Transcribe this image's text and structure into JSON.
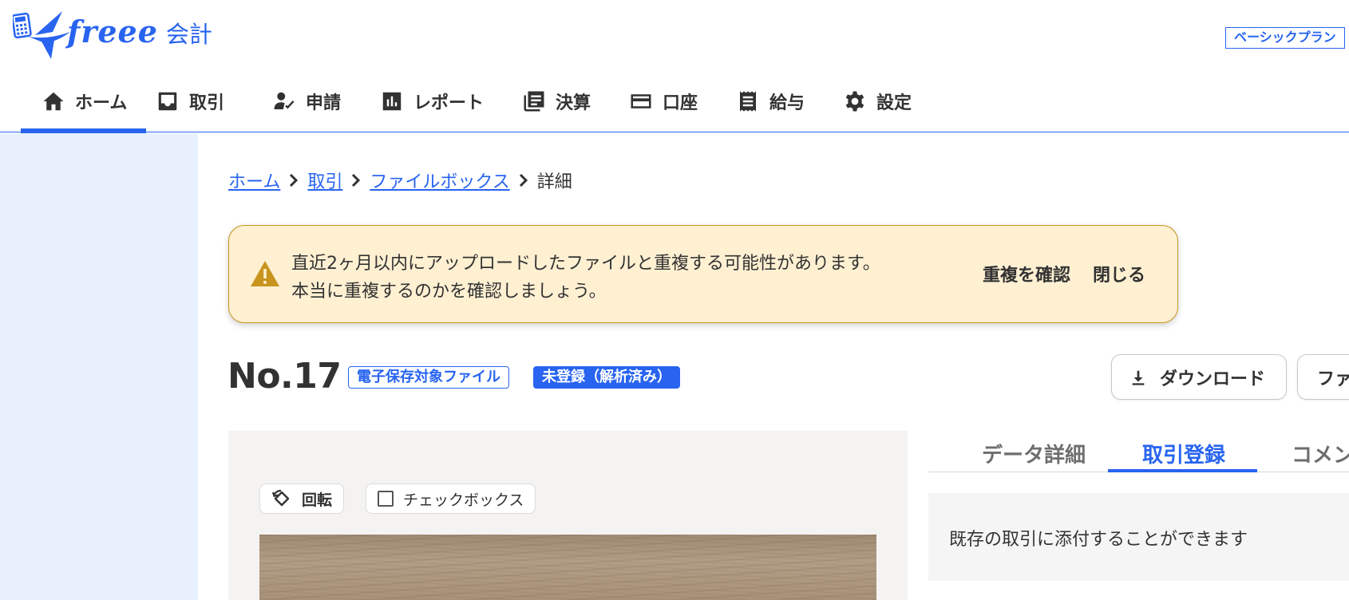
{
  "header": {
    "logo_text": "freee",
    "product_name": "会計",
    "plan_label": "ベーシックプラン"
  },
  "nav": {
    "items": [
      {
        "label": "ホーム",
        "icon": "home-icon",
        "active": true
      },
      {
        "label": "取引",
        "icon": "inbox-icon"
      },
      {
        "label": "申請",
        "icon": "person-check-icon"
      },
      {
        "label": "レポート",
        "icon": "bar-chart-icon"
      },
      {
        "label": "決算",
        "icon": "document-stack-icon"
      },
      {
        "label": "口座",
        "icon": "credit-card-icon"
      },
      {
        "label": "給与",
        "icon": "receipt-icon"
      },
      {
        "label": "設定",
        "icon": "gear-icon"
      }
    ]
  },
  "breadcrumb": {
    "items": [
      "ホーム",
      "取引",
      "ファイルボックス"
    ],
    "current": "詳細"
  },
  "banner": {
    "line1": "直近2ヶ月以内にアップロードしたファイルと重複する可能性があります。",
    "line2": "本当に重複するのかを確認しましょう。",
    "confirm_label": "重複を確認",
    "close_label": "閉じる",
    "icon": "warning-triangle-icon",
    "color": "#fff0d2"
  },
  "document": {
    "title": "No.17",
    "tag_storage": "電子保存対象ファイル",
    "tag_status": "未登録（解析済み）"
  },
  "actions": {
    "download_label": "ダウンロード",
    "file_label": "ファ"
  },
  "preview": {
    "rotate_label": "回転",
    "checkbox_label": "チェックボックス"
  },
  "tabs": {
    "items": [
      "データ詳細",
      "取引登録",
      "コメン"
    ],
    "active_index": 1
  },
  "attach": {
    "message": "既存の取引に添付することができます"
  },
  "colors": {
    "accent": "#2864f0",
    "side_panel": "#e8f0fd",
    "warning_border": "#c8941e"
  }
}
